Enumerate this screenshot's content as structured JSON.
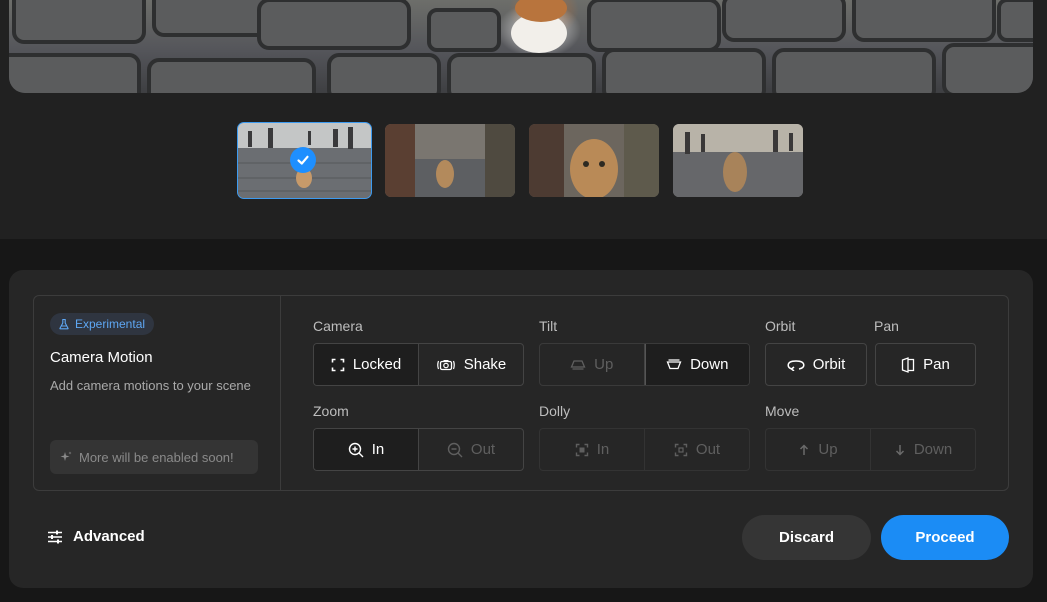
{
  "preview": {
    "image": "cat-on-cobblestone-street"
  },
  "thumbnails": [
    {
      "name": "thumbnail-1",
      "image": "cat-walking-street-wide",
      "selected": true
    },
    {
      "name": "thumbnail-2",
      "image": "cat-sitting-street-side"
    },
    {
      "name": "thumbnail-3",
      "image": "cat-closeup-street-cafe"
    },
    {
      "name": "thumbnail-4",
      "image": "cat-walking-street-center"
    }
  ],
  "panel": {
    "badge": "Experimental",
    "title": "Camera Motion",
    "subtitle": "Add camera motions to your scene",
    "soon": "More will be enabled soon!"
  },
  "groups": {
    "camera": {
      "label": "Camera",
      "locked": "Locked",
      "shake": "Shake"
    },
    "tilt": {
      "label": "Tilt",
      "up": "Up",
      "down": "Down"
    },
    "orbit": {
      "label": "Orbit",
      "button": "Orbit"
    },
    "pan": {
      "label": "Pan",
      "button": "Pan"
    },
    "zoom": {
      "label": "Zoom",
      "in": "In",
      "out": "Out"
    },
    "dolly": {
      "label": "Dolly",
      "in": "In",
      "out": "Out"
    },
    "move": {
      "label": "Move",
      "up": "Up",
      "down": "Down"
    }
  },
  "footer": {
    "advanced": "Advanced",
    "discard": "Discard",
    "proceed": "Proceed"
  },
  "colors": {
    "accent": "#1b8cf5",
    "badge_text": "#5ea7f3",
    "panel": "#262626"
  }
}
